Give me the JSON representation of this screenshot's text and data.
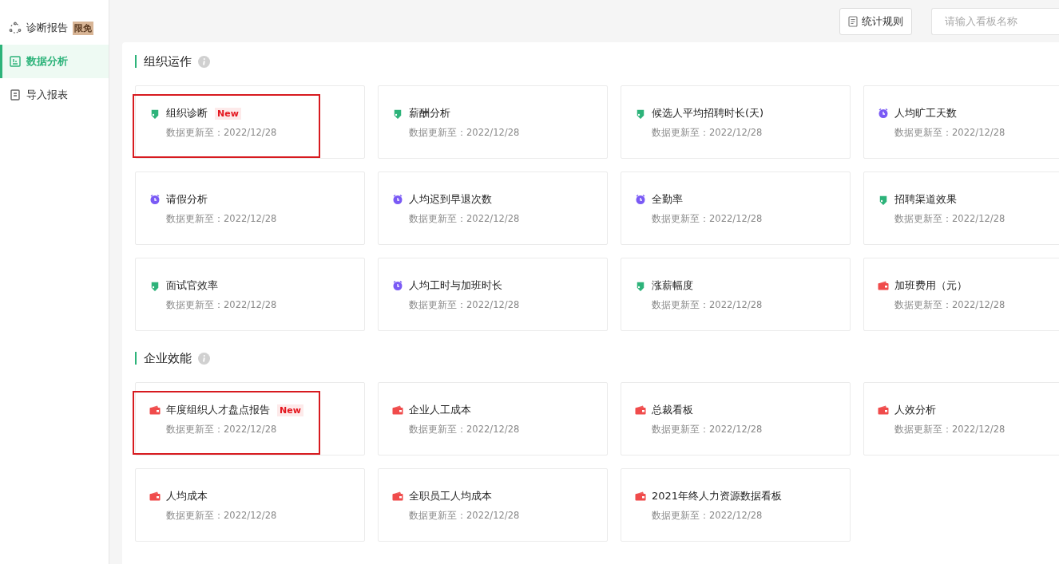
{
  "sidebar": {
    "items": [
      {
        "label": "诊断报告",
        "badge": "限免",
        "kind": "cycle",
        "selected": false
      },
      {
        "label": "数据分析",
        "kind": "chart",
        "selected": true
      },
      {
        "label": "导入报表",
        "kind": "doc",
        "selected": false
      }
    ]
  },
  "toolbar": {
    "rules_button": "统计规则",
    "search": {
      "placeholder": "请输入看板名称"
    }
  },
  "sections": [
    {
      "title": "组织运作",
      "cards": [
        {
          "title": "组织诊断",
          "badge": "New",
          "kind": "tag",
          "highlighted": true,
          "updated": "数据更新至：2022/12/28"
        },
        {
          "title": "薪酬分析",
          "kind": "tag",
          "highlighted": false,
          "updated": "数据更新至：2022/12/28"
        },
        {
          "title": "候选人平均招聘时长(天)",
          "kind": "tag",
          "highlighted": false,
          "updated": "数据更新至：2022/12/28"
        },
        {
          "title": "人均旷工天数",
          "kind": "clock",
          "highlighted": false,
          "updated": "数据更新至：2022/12/28"
        },
        {
          "title": "请假分析",
          "kind": "clock",
          "highlighted": false,
          "updated": "数据更新至：2022/12/28"
        },
        {
          "title": "人均迟到早退次数",
          "kind": "clock",
          "highlighted": false,
          "updated": "数据更新至：2022/12/28"
        },
        {
          "title": "全勤率",
          "kind": "clock",
          "highlighted": false,
          "updated": "数据更新至：2022/12/28"
        },
        {
          "title": "招聘渠道效果",
          "kind": "tag",
          "highlighted": false,
          "updated": "数据更新至：2022/12/28"
        },
        {
          "title": "面试官效率",
          "kind": "tag",
          "highlighted": false,
          "updated": "数据更新至：2022/12/28"
        },
        {
          "title": "人均工时与加班时长",
          "kind": "clock",
          "highlighted": false,
          "updated": "数据更新至：2022/12/28"
        },
        {
          "title": "涨薪幅度",
          "kind": "tag",
          "highlighted": false,
          "updated": "数据更新至：2022/12/28"
        },
        {
          "title": "加班费用（元）",
          "kind": "wallet",
          "highlighted": false,
          "updated": "数据更新至：2022/12/28"
        }
      ]
    },
    {
      "title": "企业效能",
      "cards": [
        {
          "title": "年度组织人才盘点报告",
          "badge": "New",
          "kind": "wallet",
          "highlighted": true,
          "updated": "数据更新至：2022/12/28"
        },
        {
          "title": "企业人工成本",
          "kind": "wallet",
          "highlighted": false,
          "updated": "数据更新至：2022/12/28"
        },
        {
          "title": "总裁看板",
          "kind": "wallet",
          "highlighted": false,
          "updated": "数据更新至：2022/12/28"
        },
        {
          "title": "人效分析",
          "kind": "wallet",
          "highlighted": false,
          "updated": "数据更新至：2022/12/28"
        },
        {
          "title": "人均成本",
          "kind": "wallet",
          "highlighted": false,
          "updated": "数据更新至：2022/12/28"
        },
        {
          "title": "全职员工人均成本",
          "kind": "wallet",
          "highlighted": false,
          "updated": "数据更新至：2022/12/28"
        },
        {
          "title": "2021年终人力资源数据看板",
          "kind": "wallet",
          "highlighted": false,
          "updated": "数据更新至：2022/12/28"
        }
      ]
    }
  ]
}
